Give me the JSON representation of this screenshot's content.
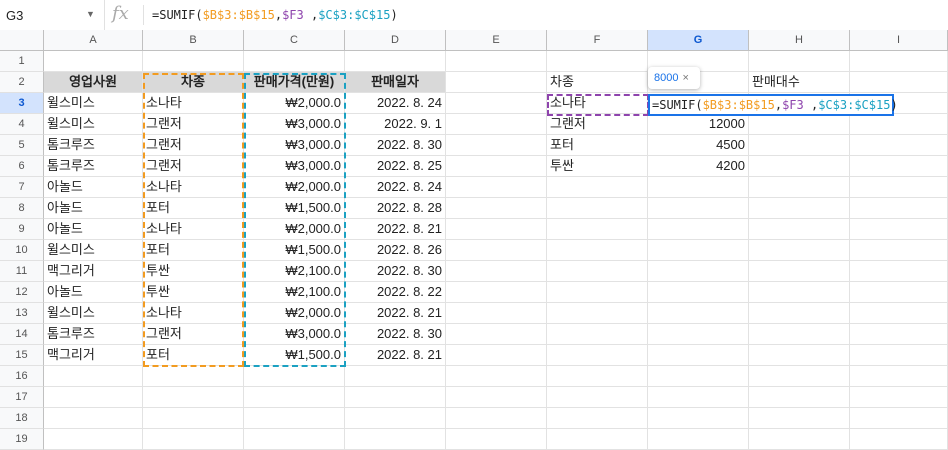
{
  "name_box": "G3",
  "fx_label": "fx",
  "formula": {
    "prefix": "=SUMIF(",
    "range": "$B$3:$B$15",
    "comma1": ",",
    "criteria": "$F3",
    "comma2": " ,",
    "sum_range": "$C$3:$C$15",
    "suffix": ")"
  },
  "tooltip": {
    "value": "8000",
    "close": "×"
  },
  "columns": [
    "A",
    "B",
    "C",
    "D",
    "E",
    "F",
    "G",
    "H",
    "I"
  ],
  "rows": [
    "1",
    "2",
    "3",
    "4",
    "5",
    "6",
    "7",
    "8",
    "9",
    "10",
    "11",
    "12",
    "13",
    "14",
    "15",
    "16",
    "17",
    "18",
    "19"
  ],
  "table": {
    "headers": [
      "영업사원",
      "차종",
      "판매가격(만원)",
      "판매일자"
    ],
    "rows": [
      [
        "윌스미스",
        "소나타",
        "₩2,000.0",
        "2022. 8. 24"
      ],
      [
        "윌스미스",
        "그랜저",
        "₩3,000.0",
        "2022. 9. 1"
      ],
      [
        "톰크루즈",
        "그랜저",
        "₩3,000.0",
        "2022. 8. 30"
      ],
      [
        "톰크루즈",
        "그랜저",
        "₩3,000.0",
        "2022. 8. 25"
      ],
      [
        "아놀드",
        "소나타",
        "₩2,000.0",
        "2022. 8. 24"
      ],
      [
        "아놀드",
        "포터",
        "₩1,500.0",
        "2022. 8. 28"
      ],
      [
        "아놀드",
        "소나타",
        "₩2,000.0",
        "2022. 8. 21"
      ],
      [
        "윌스미스",
        "포터",
        "₩1,500.0",
        "2022. 8. 26"
      ],
      [
        "맥그리거",
        "투싼",
        "₩2,100.0",
        "2022. 8. 30"
      ],
      [
        "아놀드",
        "투싼",
        "₩2,100.0",
        "2022. 8. 22"
      ],
      [
        "윌스미스",
        "소나타",
        "₩2,000.0",
        "2022. 8. 21"
      ],
      [
        "톰크루즈",
        "그랜저",
        "₩3,000.0",
        "2022. 8. 30"
      ],
      [
        "맥그리거",
        "포터",
        "₩1,500.0",
        "2022. 8. 21"
      ]
    ]
  },
  "summary": {
    "headers": [
      "차종",
      "",
      "판매대수"
    ],
    "rows": [
      [
        "소나타",
        ""
      ],
      [
        "그랜저",
        "12000"
      ],
      [
        "포터",
        "4500"
      ],
      [
        "투싼",
        "4200"
      ]
    ]
  }
}
